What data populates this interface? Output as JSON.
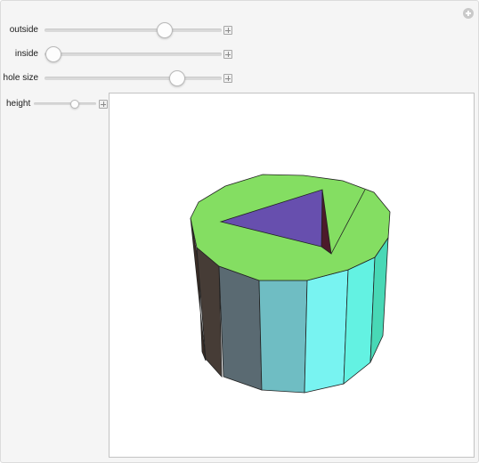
{
  "controls": {
    "outside": {
      "label": "outside",
      "value": 0.68
    },
    "inside": {
      "label": "inside",
      "value": 0.05
    },
    "hole_size": {
      "label": "hole size",
      "value": 0.75
    },
    "height": {
      "label": "height",
      "value": 0.65
    }
  },
  "colors": {
    "top_face": "#84de62",
    "hole": "#674fae",
    "hole_dark": "#4c1a2a",
    "sides": [
      "#3a2c25",
      "#463c36",
      "#5a6a72",
      "#6fbdc3",
      "#78f3f1",
      "#63f2e2",
      "#48d8b6"
    ]
  },
  "icons": {
    "options": "plus-circle-icon",
    "step": "plus-square-icon"
  }
}
